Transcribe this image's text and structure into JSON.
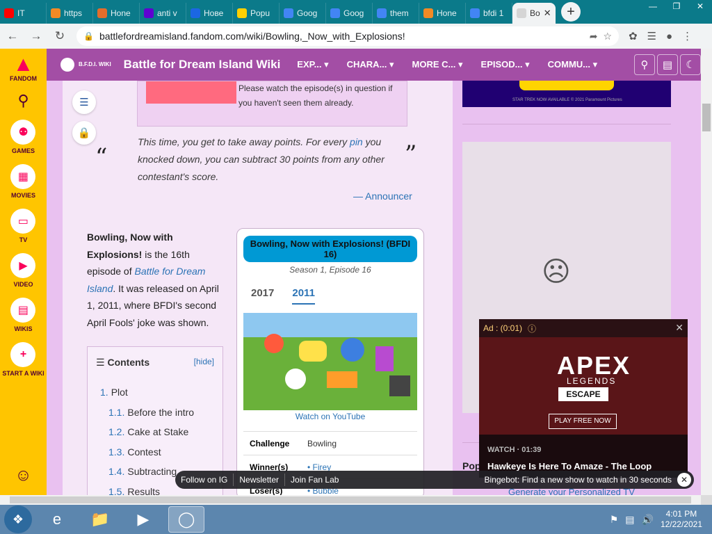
{
  "browser": {
    "tabs": [
      {
        "label": "IT",
        "icon": "youtube-icon",
        "color": "#ff0000"
      },
      {
        "label": "https",
        "icon": "deviantart-icon",
        "color": "#f18a25"
      },
      {
        "label": "Hone",
        "icon": "home-icon",
        "color": "#e36d2b"
      },
      {
        "label": "anti v",
        "icon": "yahoo-icon",
        "color": "#5f01d1"
      },
      {
        "label": "Нове",
        "icon": "play-icon",
        "color": "#1b67e3"
      },
      {
        "label": "Popu",
        "icon": "smile-icon",
        "color": "#ffd000"
      },
      {
        "label": "Goog",
        "icon": "google-icon",
        "color": "#4285f4"
      },
      {
        "label": "Goog",
        "icon": "google-icon",
        "color": "#4285f4"
      },
      {
        "label": "them",
        "icon": "google-icon",
        "color": "#4285f4"
      },
      {
        "label": "Hone",
        "icon": "deviantart-icon",
        "color": "#f18a25"
      },
      {
        "label": "bfdi 1",
        "icon": "google-icon",
        "color": "#4285f4"
      },
      {
        "label": "Bo",
        "icon": "fandom-icon",
        "color": "#d5d5d5"
      }
    ],
    "url": "battlefordreamisland.fandom.com/wiki/Bowling,_Now_with_Explosions!"
  },
  "rail": {
    "logo": "FANDOM",
    "items": [
      {
        "label": "GAMES",
        "icon": "games-icon"
      },
      {
        "label": "MOVIES",
        "icon": "movies-icon"
      },
      {
        "label": "TV",
        "icon": "tv-icon"
      },
      {
        "label": "VIDEO",
        "icon": "video-icon"
      },
      {
        "label": "WIKIS",
        "icon": "wikis-icon"
      },
      {
        "label": "START A WIKI",
        "icon": "plus-icon"
      }
    ]
  },
  "wiki": {
    "tagline": "B.F.D.I. WIKI",
    "title": "Battle for Dream Island Wiki",
    "menu": [
      "EXP...",
      "CHARA...",
      "MORE C...",
      "EPISOD...",
      "COMMU..."
    ]
  },
  "article": {
    "notice": "Please watch the episode(s) in question if you haven't seen them already.",
    "quote_before": "This time, you get to take away points. For every",
    "quote_link": "pin",
    "quote_after": "you knocked down, you can subtract 30 points from any other contestant's score.",
    "attribution_dash": "— ",
    "attribution": "Announcer",
    "intro_bold": "Bowling, Now with Explosions!",
    "intro_1": " is the 16th episode of ",
    "intro_link": "Battle for Dream Island",
    "intro_2": ". It was released on April 1, 2011, where BFDI's second April Fools' joke was shown."
  },
  "toc": {
    "title": "Contents",
    "hide": "[hide]",
    "items": [
      {
        "num": "1.",
        "label": "Plot"
      },
      {
        "num": "1.1.",
        "label": "Before the intro"
      },
      {
        "num": "1.2.",
        "label": "Cake at Stake"
      },
      {
        "num": "1.3.",
        "label": "Contest"
      },
      {
        "num": "1.4.",
        "label": "Subtracting"
      },
      {
        "num": "1.5.",
        "label": "Results"
      }
    ]
  },
  "infobox": {
    "title": "Bowling, Now with Explosions! (BFDI 16)",
    "subtitle": "Season 1, Episode 16",
    "tabs": [
      "2017",
      "2011"
    ],
    "watch": "Watch on YouTube",
    "rows": [
      {
        "key": "Challenge",
        "value": "Bowling"
      },
      {
        "key": "Winner(s)",
        "value": "Firey"
      },
      {
        "key": "Loser(s)",
        "value": "Bubble"
      }
    ]
  },
  "sidebar": {
    "ad_fine": "STAR TREK NOW AVAILABLE © 2021 Paramount Pictures",
    "popular": "Popular",
    "gen": "Generate your Personalized TV"
  },
  "video": {
    "ad_label": "Ad : (0:01)",
    "apex": "APEX",
    "legends": "LEGENDS",
    "escape": "ESCAPE",
    "play": "PLAY FREE NOW",
    "watch": "WATCH · 01:39",
    "title": "Hawkeye Is Here To Amaze - The Loop"
  },
  "bottom_bar": {
    "items": [
      "Follow on IG",
      "Newsletter",
      "Join Fan Lab"
    ],
    "bingebot": "Bingebot: Find a new show to watch in 30 seconds"
  },
  "taskbar": {
    "time": "4:01 PM",
    "date": "12/22/2021"
  }
}
